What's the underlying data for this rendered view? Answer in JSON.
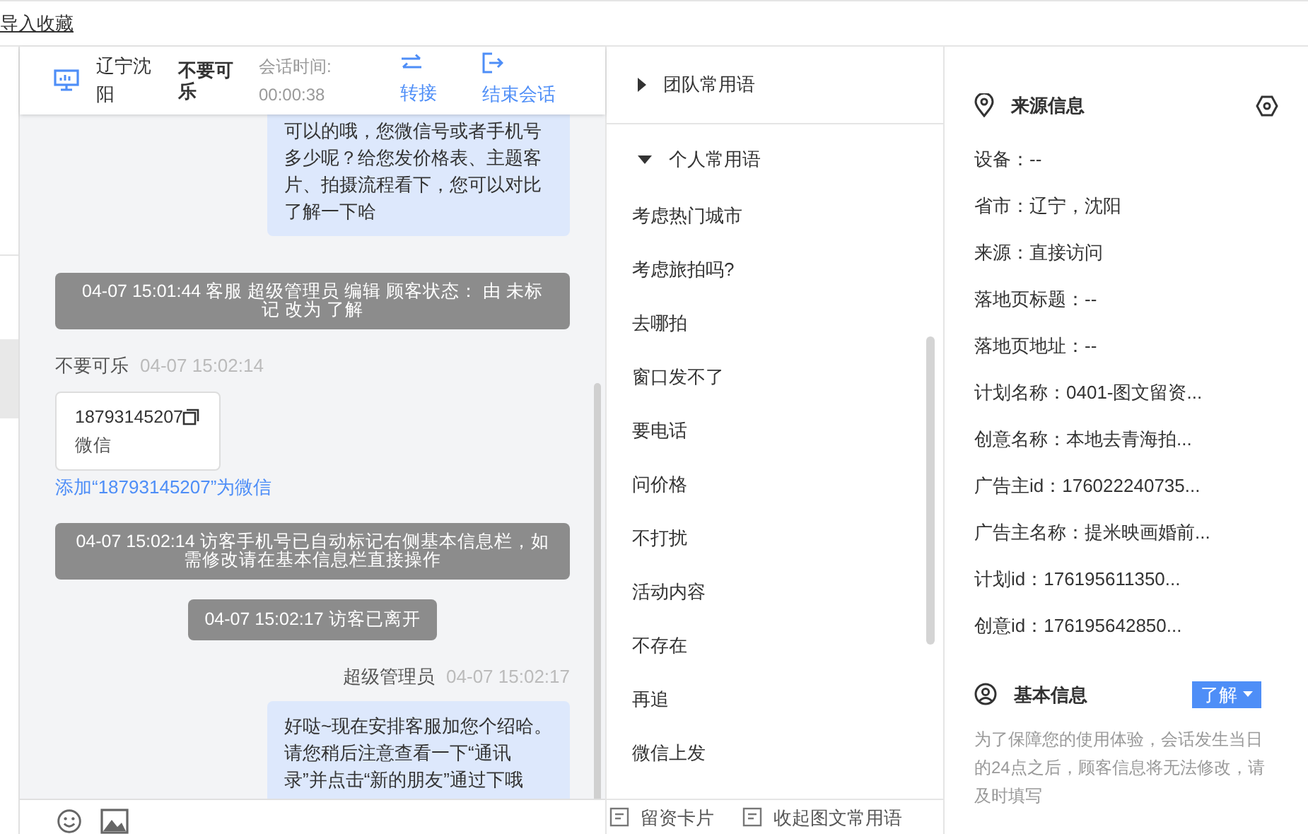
{
  "top_link": "导入收藏",
  "header": {
    "city": "辽宁沈阳",
    "visitor": "不要可乐",
    "duration_label": "会话时间:",
    "duration": "00:00:38",
    "actions": [
      {
        "kind": "transfer",
        "label": "转接"
      },
      {
        "kind": "end",
        "label": "结束会话"
      }
    ]
  },
  "messages": [
    {
      "kind": "agent_bubble",
      "text": "可以的哦，您微信号或者手机号多少呢？给您发价格表、主题客片、拍摄流程看下，您可以对比了解一下哈"
    },
    {
      "kind": "system",
      "text": "04-07 15:01:44 客服 超级管理员 编辑 顾客状态： 由 未标记 改为 了解"
    },
    {
      "kind": "visitor_card",
      "sender": "不要可乐",
      "time": "04-07 15:02:14",
      "card_number": "18793145207",
      "card_type": "微信",
      "link": "添加“18793145207”为微信"
    },
    {
      "kind": "system",
      "text": "04-07 15:02:14 访客手机号已自动标记右侧基本信息栏，如需修改请在基本信息栏直接操作"
    },
    {
      "kind": "system_short",
      "text": "04-07 15:02:17 访客已离开"
    },
    {
      "kind": "agent_header",
      "sender": "超级管理员",
      "time": "04-07 15:02:17"
    },
    {
      "kind": "agent_bubble",
      "text": "好哒~现在安排客服加您个绍哈。请您稍后注意查看一下“通讯录”并点击“新的朋友”通过下哦"
    }
  ],
  "phrase_groups": [
    {
      "label": "团队常用语",
      "expanded": false
    },
    {
      "label": "个人常用语",
      "expanded": true
    }
  ],
  "phrases": [
    "考虑热门城市",
    "考虑旅拍吗?",
    "去哪拍",
    "窗口发不了",
    "要电话",
    "问价格",
    "不打扰",
    "活动内容",
    "不存在",
    "再追",
    "微信上发"
  ],
  "bottom_actions": [
    "留资卡片",
    "收起图文常用语"
  ],
  "source_info": {
    "title": "来源信息",
    "rows": [
      "设备：--",
      "省市：辽宁，沈阳",
      "来源：直接访问",
      "落地页标题：--",
      "落地页地址：--",
      "计划名称：0401-图文留资...",
      "创意名称：本地去青海拍...",
      "广告主id：176022240735...",
      "广告主名称：提米映画婚前...",
      "计划id：176195611350...",
      "创意id：176195642850..."
    ]
  },
  "basic_info": {
    "title": "基本信息",
    "status": "了解",
    "note": "为了保障您的使用体验，会话发生当日的24点之后，顾客信息将无法修改，请及时填写"
  }
}
